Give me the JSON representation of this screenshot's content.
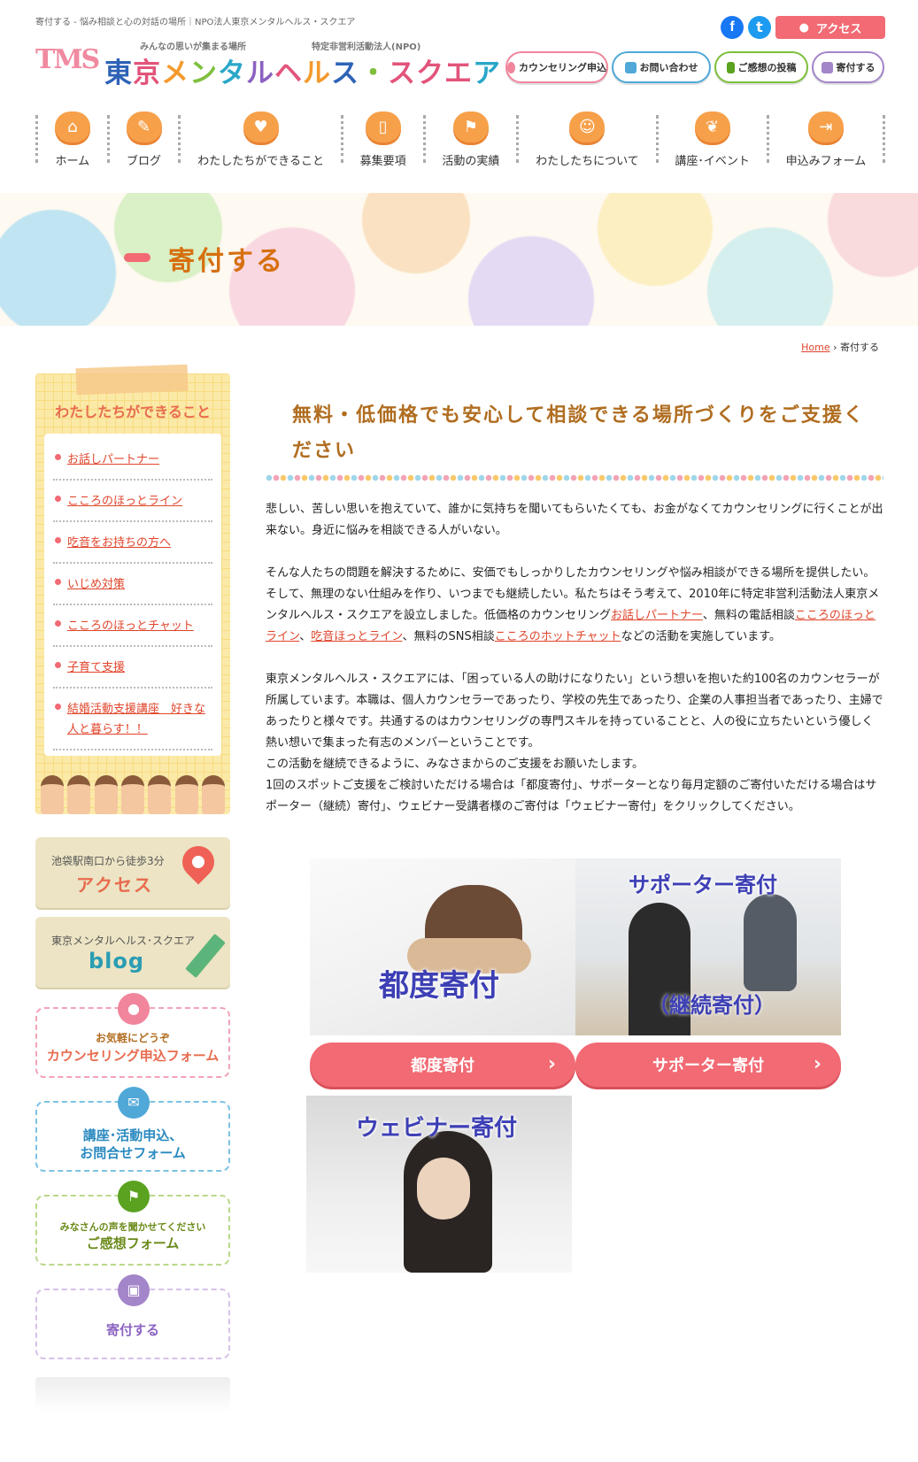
{
  "header": {
    "tagline": "寄付する - 悩み相談と心の対話の場所｜NPO法人東京メンタルヘルス・スクエア",
    "logo_mark": "TMS",
    "logo_sub1": "みんなの思いが集まる場所",
    "logo_sub2": "特定非営利活動法人(NPO)",
    "logo_name": [
      "東",
      "京",
      "メ",
      "ン",
      "タ",
      "ル",
      "ヘ",
      "ル",
      "ス",
      "・",
      "スクエ",
      "ア"
    ],
    "facebook": "f",
    "twitter": "t",
    "access_label": "アクセス",
    "buttons": {
      "counseling": "カウンセリング申込",
      "contact": "お問い合わせ",
      "feedback": "ご感想の投稿",
      "donate": "寄付する"
    }
  },
  "nav": [
    {
      "label": "ホーム",
      "icon": "home-icon",
      "glyph": "⌂"
    },
    {
      "label": "ブログ",
      "icon": "pencil-icon",
      "glyph": "✎"
    },
    {
      "label": "わたしたちができること",
      "icon": "heart-icon",
      "glyph": "♥"
    },
    {
      "label": "募集要項",
      "icon": "book-icon",
      "glyph": "▯"
    },
    {
      "label": "活動の実績",
      "icon": "signpost-icon",
      "glyph": "⚑"
    },
    {
      "label": "わたしたちについて",
      "icon": "people-icon",
      "glyph": "☺"
    },
    {
      "label": "講座･イベント",
      "icon": "leaf-icon",
      "glyph": "❦"
    },
    {
      "label": "申込みフォーム",
      "icon": "enter-icon",
      "glyph": "⇥"
    }
  ],
  "hero": {
    "title": "寄付する"
  },
  "breadcrumb": {
    "home": "Home",
    "sep": "›",
    "current": "寄付する"
  },
  "sidebar": {
    "title": "わたしたちができること",
    "items": [
      "お話しパートナー",
      "こころのほっとライン",
      "吃音をお持ちの方へ",
      "いじめ対策",
      "こころのほっとチャット",
      "子育て支援",
      "結婚活動支援講座　好きな人と暮らす！！"
    ],
    "access_card": {
      "line1": "池袋駅南口から徒歩3分",
      "line2": "アクセス"
    },
    "blog_card": {
      "line1": "東京メンタルヘルス･スクエア",
      "line2": "blog"
    },
    "form_counseling": {
      "line1": "お気軽にどうぞ",
      "line2": "カウンセリング申込フォーム"
    },
    "form_contact": {
      "line1": "講座･活動申込、",
      "line2": "お問合せフォーム"
    },
    "form_feedback": {
      "line1": "みなさんの声を聞かせてください",
      "line2": "ご感想フォーム"
    },
    "form_donate": {
      "line2": "寄付する"
    }
  },
  "main": {
    "title": "無料・低価格でも安心して相談できる場所づくりをご支援ください",
    "p1": "悲しい、苦しい思いを抱えていて、誰かに気持ちを聞いてもらいたくても、お金がなくてカウンセリングに行くことが出来ない。身近に悩みを相談できる人がいない。",
    "p2_a": "そんな人たちの問題を解決するために、安価でもしっかりしたカウンセリングや悩み相談ができる場所を提供したい。そして、無理のない仕組みを作り、いつまでも継続したい。私たちはそう考えて、2010年に特定非営利活動法人東京メンタルヘルス・スクエアを設立しました。低価格のカウンセリング",
    "p2_link1": "お話しパートナー",
    "p2_b": "、無料の電話相談",
    "p2_link2": "こころのほっとライン",
    "p2_c": "、",
    "p2_link3": "吃音ほっとライン",
    "p2_d": "、無料のSNS相談",
    "p2_link4": "こころのホットチャット",
    "p2_e": "などの活動を実施しています。",
    "p3": "東京メンタルヘルス・スクエアには、「困っている人の助けになりたい」という想いを抱いた約100名のカウンセラーが所属しています。本職は、個人カウンセラーであったり、学校の先生であったり、企業の人事担当者であったり、主婦であったりと様々です。共通するのはカウンセリングの専門スキルを持っていることと、人の役に立ちたいという優しく熱い想いで集まった有志のメンバーということです。",
    "p4": "この活動を継続できるように、みなさまからのご支援をお願いたします。",
    "p5": "1回のスポットご支援をご検討いただける場合は「都度寄付」、サポーターとなり毎月定額のご寄付いただける場合はサポーター（継続）寄付」、ウェビナー受講者様のご寄付は「ウェビナー寄付」をクリックしてください。",
    "donation_cards": {
      "one_time_caption": "都度寄付",
      "supporter_caption": "サポーター寄付",
      "supporter_caption2": "（継続寄付）",
      "webinar_caption": "ウェビナー寄付"
    },
    "buttons": {
      "one_time": "都度寄付",
      "supporter": "サポーター寄付",
      "chevron": "›"
    }
  },
  "colors": {
    "accent": "#f26a73",
    "orange": "#f7a04a",
    "link": "#e0452b",
    "title": "#b06d20"
  }
}
